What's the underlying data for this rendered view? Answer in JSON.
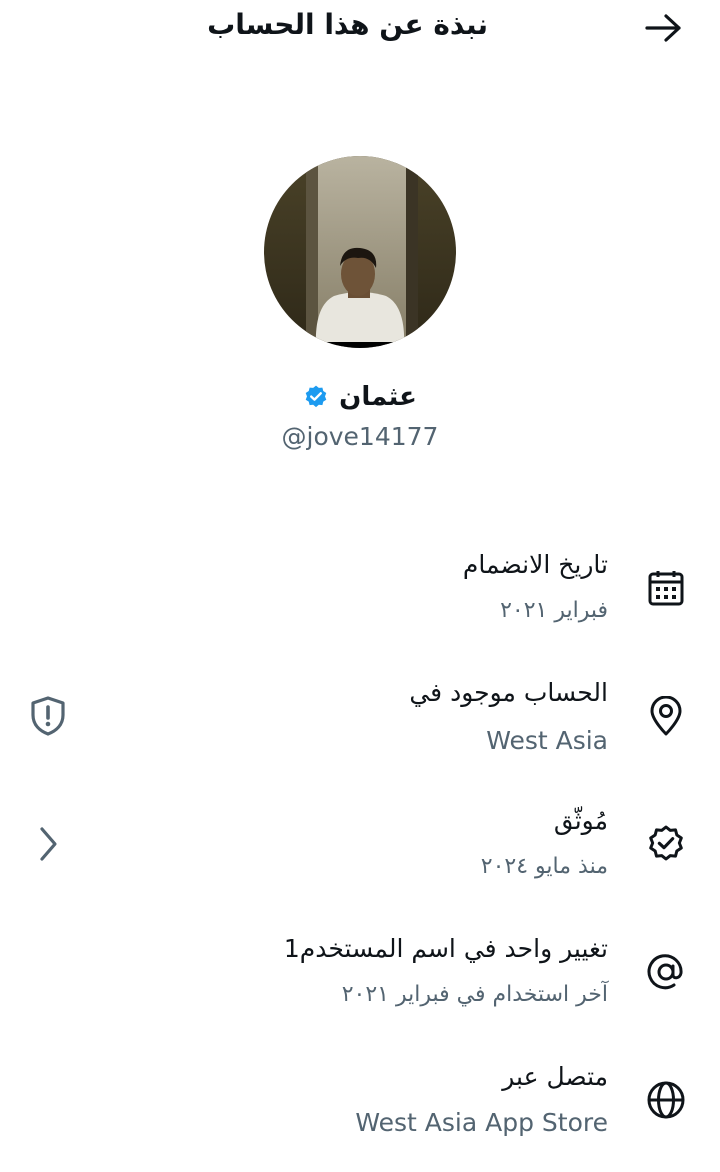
{
  "header": {
    "title": "نبذة عن هذا الحساب",
    "back_icon": "arrow-right-icon"
  },
  "profile": {
    "display_name": "عثمان",
    "handle": "@jove14177",
    "verified_color": "#1d9bf0"
  },
  "rows": [
    {
      "title": "تاريخ الانضمام",
      "subtitle": "فبراير ٢٠٢١",
      "icon": "calendar-icon"
    },
    {
      "title": "الحساب موجود في",
      "subtitle": "West Asia",
      "icon": "location-pin-icon",
      "left_icon": "shield-alert-icon"
    },
    {
      "title": "مُوثّق",
      "subtitle": "منذ مايو ٢٠٢٤",
      "icon": "verified-badge-icon",
      "left_icon": "chevron-right-icon"
    },
    {
      "title": "تغيير واحد في اسم المستخدم1",
      "subtitle": "آخر استخدام في فبراير ٢٠٢١",
      "icon": "at-sign-icon"
    },
    {
      "title": "متصل عبر",
      "subtitle": "West Asia App Store",
      "icon": "globe-icon"
    }
  ]
}
